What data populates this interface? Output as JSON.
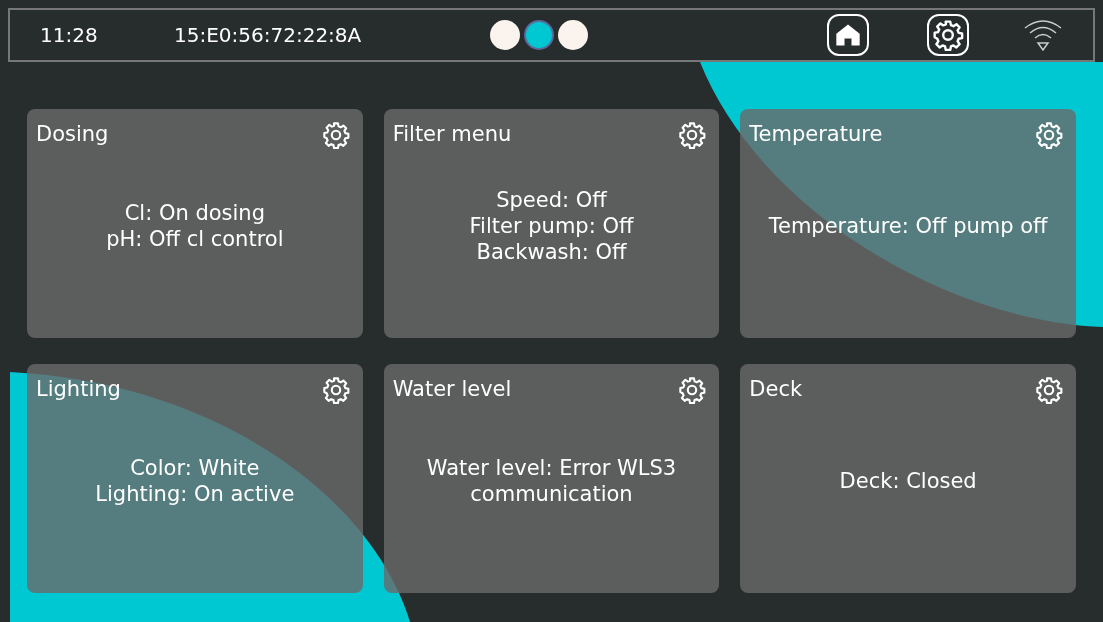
{
  "status_bar": {
    "time": "11:28",
    "mac_address": "15:E0:56:72:22:8A",
    "pages": [
      {
        "selected": false
      },
      {
        "selected": true
      },
      {
        "selected": false
      }
    ]
  },
  "cards": [
    {
      "title": "Dosing",
      "lines": [
        "Cl: On dosing",
        "pH: Off cl control"
      ]
    },
    {
      "title": "Filter menu",
      "lines": [
        "Speed: Off",
        "Filter pump: Off",
        "Backwash: Off"
      ]
    },
    {
      "title": "Temperature",
      "lines": [
        "Temperature: Off pump off"
      ]
    },
    {
      "title": "Lighting",
      "lines": [
        "Color: White",
        "Lighting: On active"
      ]
    },
    {
      "title": "Water level",
      "lines": [
        "Water level: Error WLS3 communication"
      ]
    },
    {
      "title": "Deck",
      "lines": [
        "Deck: Closed"
      ]
    }
  ]
}
